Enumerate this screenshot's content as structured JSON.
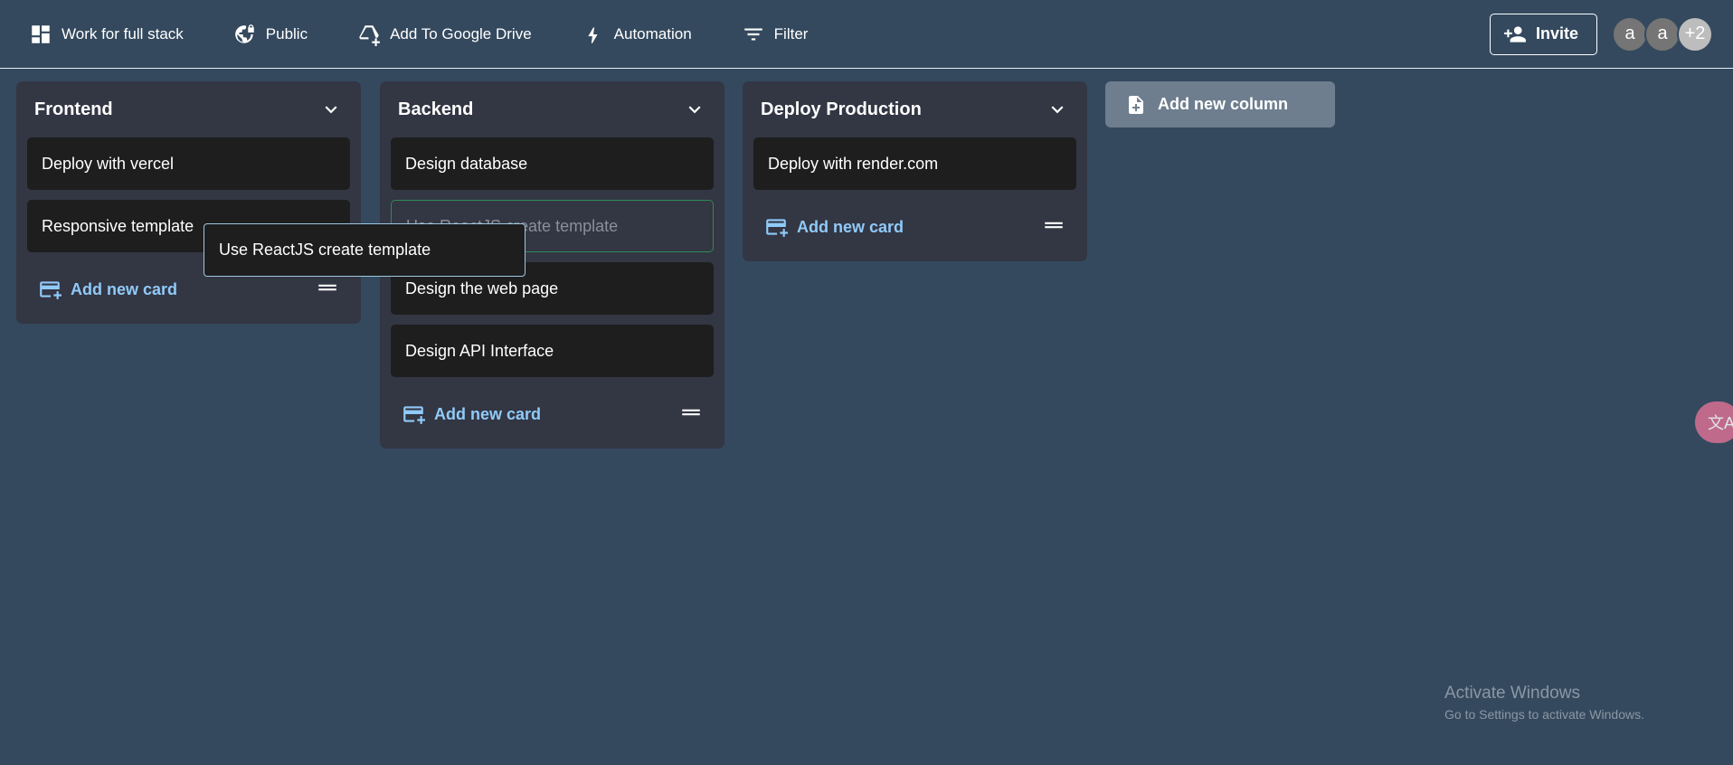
{
  "toolbar": {
    "board_title": "Work for full stack",
    "visibility": "Public",
    "drive": "Add To Google Drive",
    "automation": "Automation",
    "filter": "Filter",
    "invite": "Invite",
    "avatars": [
      "a",
      "a"
    ],
    "more_count": "+2"
  },
  "columns": [
    {
      "title": "Frontend",
      "cards": [
        "Deploy with vercel",
        "Responsive template"
      ],
      "add_label": "Add new card"
    },
    {
      "title": "Backend",
      "cards": [
        "Design database",
        "Use ReactJS create template",
        "Design the web page",
        "Design API Interface"
      ],
      "add_label": "Add new card"
    },
    {
      "title": "Deploy Production",
      "cards": [
        "Deploy with render.com"
      ],
      "add_label": "Add new card"
    }
  ],
  "add_column": "Add new column",
  "drag_ghost": "Use ReactJS create template",
  "translate_fab": "文A",
  "watermark": {
    "title": "Activate Windows",
    "subtitle": "Go to Settings to activate Windows."
  },
  "colors": {
    "background": "#34495e",
    "column": "#333643",
    "card": "#1e1e1e",
    "accent": "#90caf9"
  }
}
